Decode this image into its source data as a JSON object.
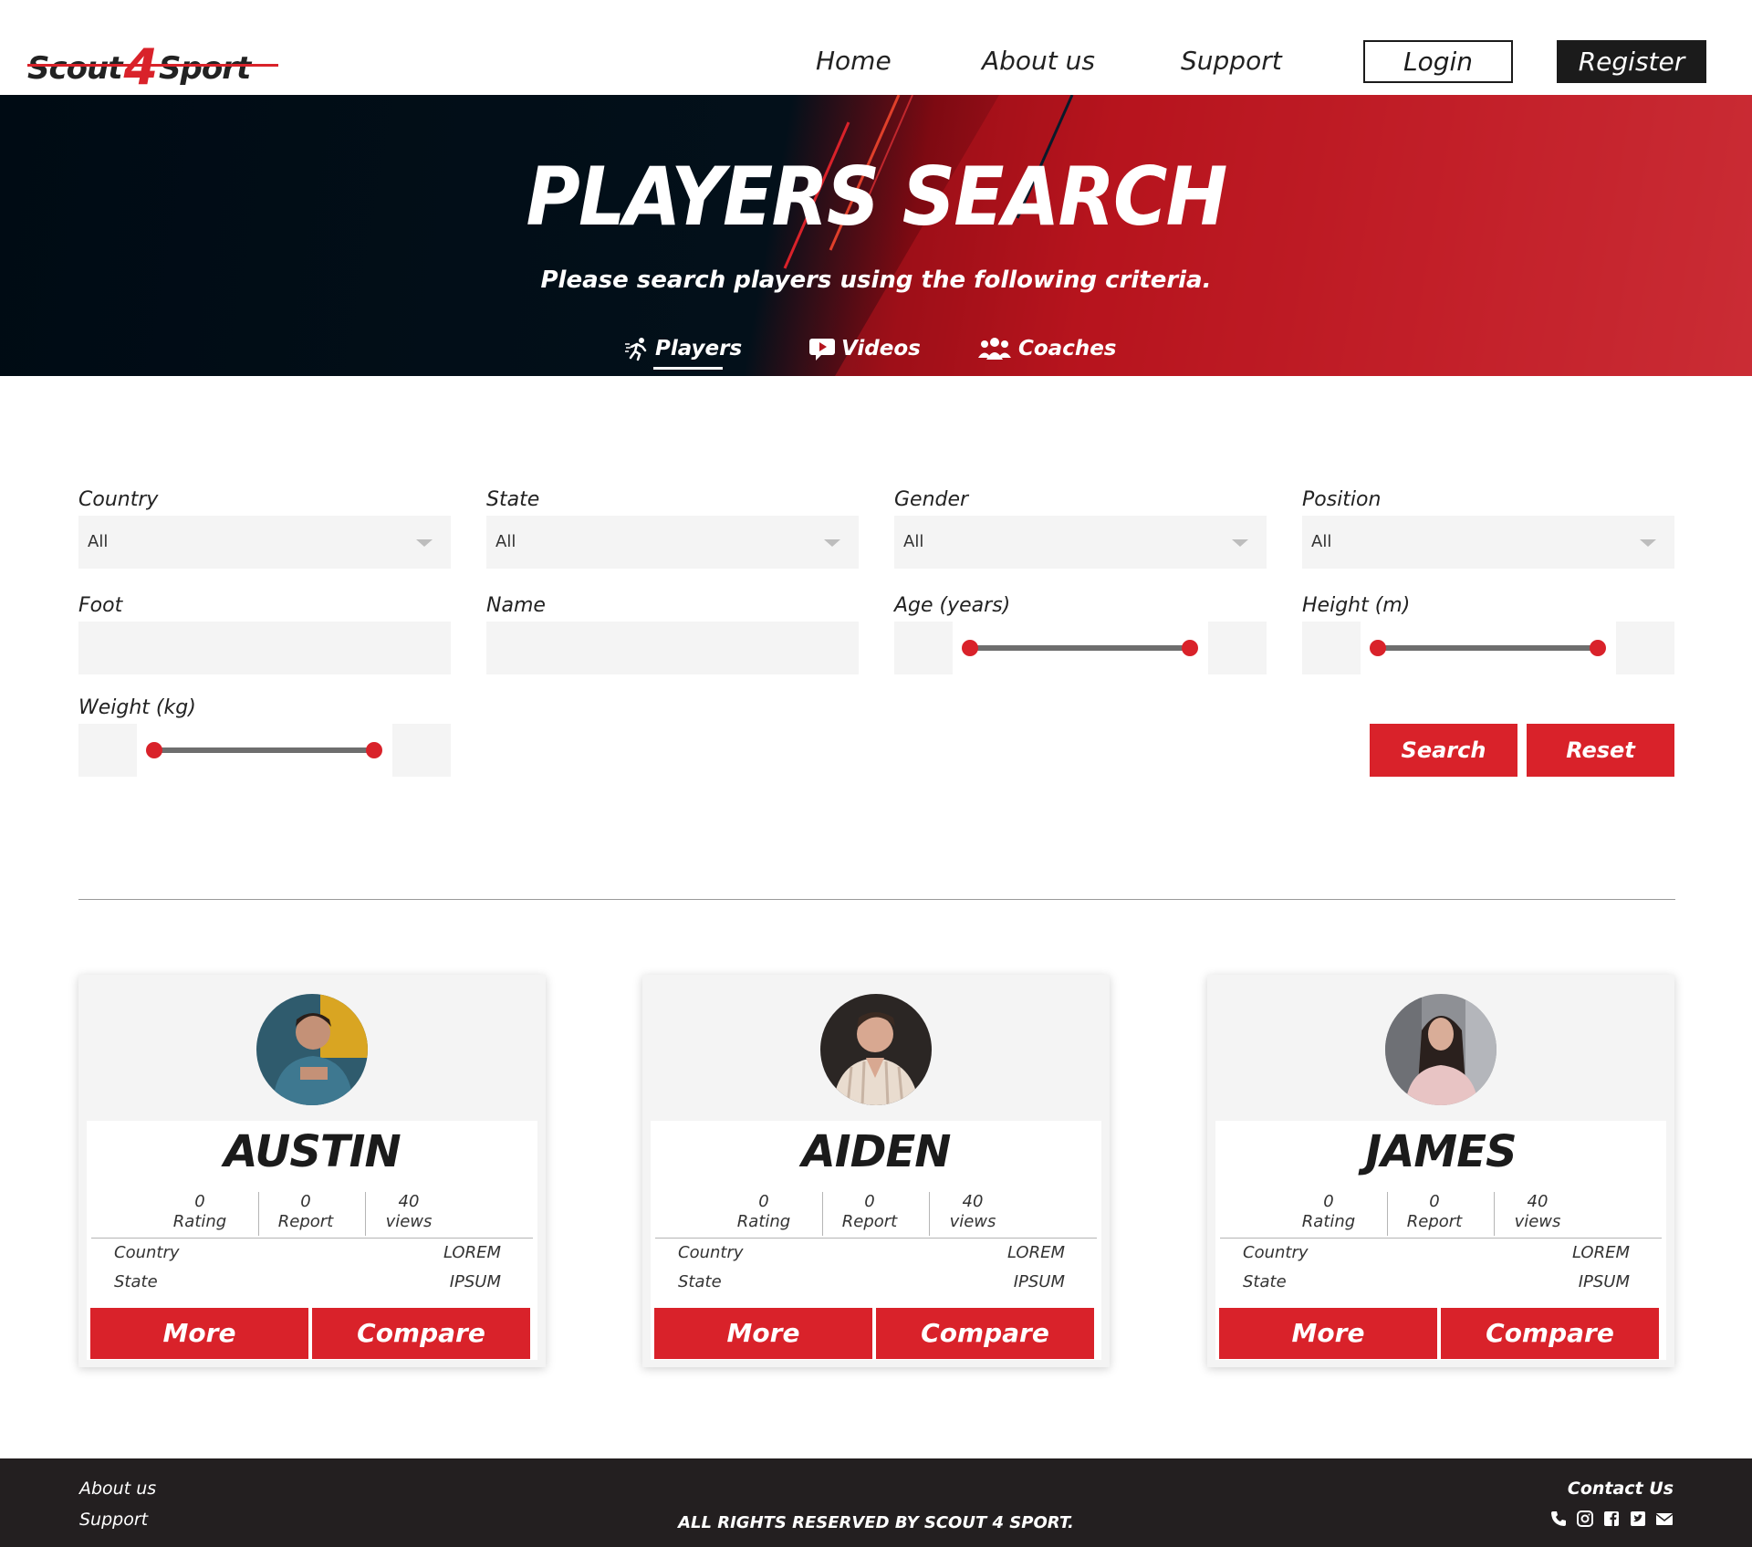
{
  "brand": {
    "logo_left": "Scout",
    "logo_four": "4",
    "logo_right": "Sport"
  },
  "nav": {
    "home": "Home",
    "about": "About us",
    "support": "Support",
    "login": "Login",
    "register": "Register"
  },
  "hero": {
    "title": "PLAYERS SEARCH",
    "subtitle": "Please search players using the following criteria.",
    "tabs": {
      "players": "Players",
      "videos": "Videos",
      "coaches": "Coaches"
    },
    "active_tab": "Players"
  },
  "filters": {
    "country": {
      "label": "Country",
      "value": "All"
    },
    "state": {
      "label": "State",
      "value": "All"
    },
    "gender": {
      "label": "Gender",
      "value": "All"
    },
    "position": {
      "label": "Position",
      "value": "All"
    },
    "foot": {
      "label": "Foot",
      "value": ""
    },
    "name": {
      "label": "Name",
      "value": ""
    },
    "age": {
      "label": "Age (years)"
    },
    "height": {
      "label": "Height (m)"
    },
    "weight": {
      "label": "Weight (kg)"
    },
    "search_label": "Search",
    "reset_label": "Reset"
  },
  "players": [
    {
      "name": "AUSTIN",
      "rating": "0",
      "rating_label": "Rating",
      "report": "0",
      "report_label": "Report",
      "views": "40",
      "views_label": "views",
      "country_label": "Country",
      "country": "LOREM",
      "state_label": "State",
      "state": "IPSUM",
      "more": "More",
      "compare": "Compare"
    },
    {
      "name": "AIDEN",
      "rating": "0",
      "rating_label": "Rating",
      "report": "0",
      "report_label": "Report",
      "views": "40",
      "views_label": "views",
      "country_label": "Country",
      "country": "LOREM",
      "state_label": "State",
      "state": "IPSUM",
      "more": "More",
      "compare": "Compare"
    },
    {
      "name": "JAMES",
      "rating": "0",
      "rating_label": "Rating",
      "report": "0",
      "report_label": "Report",
      "views": "40",
      "views_label": "views",
      "country_label": "Country",
      "country": "LOREM",
      "state_label": "State",
      "state": "IPSUM",
      "more": "More",
      "compare": "Compare"
    }
  ],
  "footer": {
    "about": "About us",
    "support": "Support",
    "copyright": "ALL RIGHTS RESERVED BY SCOUT 4 SPORT.",
    "contact": "Contact Us",
    "icons": [
      "phone-icon",
      "instagram-icon",
      "facebook-icon",
      "twitter-icon",
      "mail-icon"
    ]
  },
  "colors": {
    "accent": "#d9222a",
    "dark": "#1b1b1b",
    "footer": "#231f20",
    "hero_dark": "#000b14"
  }
}
